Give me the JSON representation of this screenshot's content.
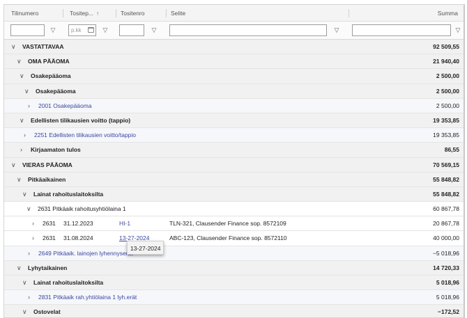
{
  "columns": {
    "tilinumero": "Tilinumero",
    "tositepvm": "Tositep...",
    "tositenro": "Tositenro",
    "selite": "Selite",
    "summa": "Summa"
  },
  "filters": {
    "date_placeholder": "p.kk"
  },
  "icons": {
    "filter": "filter-icon",
    "sort": "sort-ascending-icon",
    "calendar": "calendar-icon",
    "expanded": "chevron-down-icon",
    "collapsed": "chevron-right-icon"
  },
  "rows": [
    {
      "label": "VASTATTAVAA",
      "amount": "92 509,55",
      "chev": "v"
    },
    {
      "label": "OMA PÄÄOMA",
      "amount": "21 940,40",
      "chev": "v"
    },
    {
      "label": "Osakepääoma",
      "amount": "2 500,00",
      "chev": "v"
    },
    {
      "label": "Osakepääoma",
      "amount": "2 500,00",
      "chev": "v"
    },
    {
      "label": "2001 Osakepääoma",
      "amount": "2 500,00",
      "chev": ">"
    },
    {
      "label": "Edellisten tilikausien voitto (tappio)",
      "amount": "19 353,85",
      "chev": "v"
    },
    {
      "label": "2251 Edellisten tilikausien voitto/tappio",
      "amount": "19 353,85",
      "chev": ">"
    },
    {
      "label": "Kirjaamaton tulos",
      "amount": "86,55",
      "chev": ">"
    },
    {
      "label": "VIERAS PÄÄOMA",
      "amount": "70 569,15",
      "chev": "v"
    },
    {
      "label": "Pitkäaikainen",
      "amount": "55 848,82",
      "chev": "v"
    },
    {
      "label": "Lainat rahoituslaitoksilta",
      "amount": "55 848,82",
      "chev": "v"
    },
    {
      "label": "2631 Pitkäaik rahoitusyhtiölaina 1",
      "amount": "60 867,78",
      "chev": "v"
    },
    {
      "label": "2631",
      "date": "31.12.2023",
      "doc": "HI-1",
      "desc": "TLN-321, Clausender Finance sop. 8572109",
      "amount": "20 867,78",
      "chev": ">"
    },
    {
      "label": "2631",
      "date": "31.08.2024",
      "doc": "13-27-2024",
      "desc": "ABC-123, Clausender Finance sop. 8572110",
      "amount": "40 000,00",
      "chev": ">"
    },
    {
      "label": "2649 Pitkäaik. lainojen lyhennyserät",
      "amount": "−5 018,96",
      "chev": ">"
    },
    {
      "label": "Lyhytaikainen",
      "amount": "14 720,33",
      "chev": "v"
    },
    {
      "label": "Lainat rahoituslaitoksilta",
      "amount": "5 018,96",
      "chev": "v"
    },
    {
      "label": "2831 Pitkäaik rah.yhtiölaina 1 lyh.erät",
      "amount": "5 018,96",
      "chev": ">"
    },
    {
      "label": "Ostovelat",
      "amount": "−172,52",
      "chev": "v"
    }
  ],
  "tooltip": {
    "text": "13-27-2024"
  }
}
